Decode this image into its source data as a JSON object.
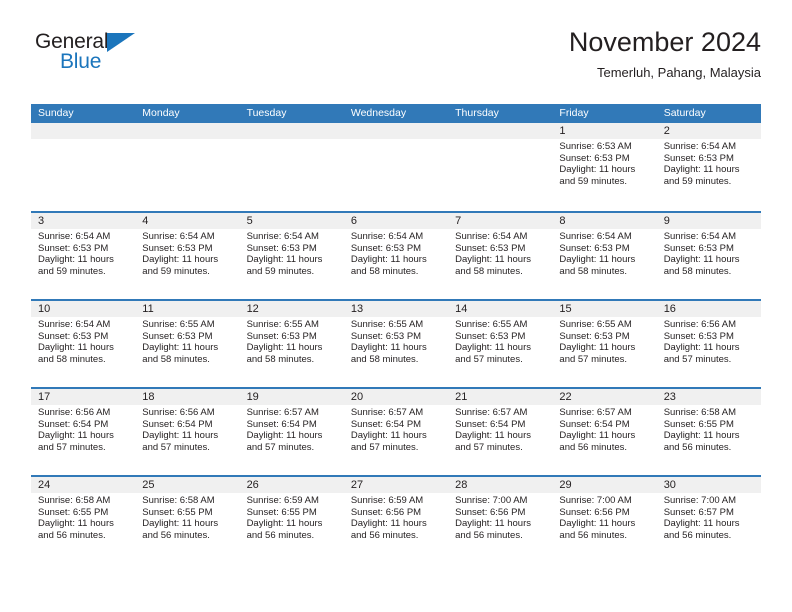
{
  "brand": {
    "name_part1": "General",
    "name_part2": "Blue",
    "color_dark": "#231f20",
    "color_blue": "#1b75bc"
  },
  "header": {
    "title": "November 2024",
    "subtitle": "Temerluh, Pahang, Malaysia"
  },
  "theme": {
    "header_blue": "#3179b8",
    "band_gray": "#f0f0f0",
    "text": "#231f20"
  },
  "weekday_headers": [
    "Sunday",
    "Monday",
    "Tuesday",
    "Wednesday",
    "Thursday",
    "Friday",
    "Saturday"
  ],
  "weeks": [
    [
      {
        "day": "",
        "sunrise": "",
        "sunset": "",
        "daylight": "",
        "empty": true
      },
      {
        "day": "",
        "sunrise": "",
        "sunset": "",
        "daylight": "",
        "empty": true
      },
      {
        "day": "",
        "sunrise": "",
        "sunset": "",
        "daylight": "",
        "empty": true
      },
      {
        "day": "",
        "sunrise": "",
        "sunset": "",
        "daylight": "",
        "empty": true
      },
      {
        "day": "",
        "sunrise": "",
        "sunset": "",
        "daylight": "",
        "empty": true
      },
      {
        "day": "1",
        "sunrise": "Sunrise: 6:53 AM",
        "sunset": "Sunset: 6:53 PM",
        "daylight": "Daylight: 11 hours and 59 minutes.",
        "empty": false
      },
      {
        "day": "2",
        "sunrise": "Sunrise: 6:54 AM",
        "sunset": "Sunset: 6:53 PM",
        "daylight": "Daylight: 11 hours and 59 minutes.",
        "empty": false
      }
    ],
    [
      {
        "day": "3",
        "sunrise": "Sunrise: 6:54 AM",
        "sunset": "Sunset: 6:53 PM",
        "daylight": "Daylight: 11 hours and 59 minutes.",
        "empty": false
      },
      {
        "day": "4",
        "sunrise": "Sunrise: 6:54 AM",
        "sunset": "Sunset: 6:53 PM",
        "daylight": "Daylight: 11 hours and 59 minutes.",
        "empty": false
      },
      {
        "day": "5",
        "sunrise": "Sunrise: 6:54 AM",
        "sunset": "Sunset: 6:53 PM",
        "daylight": "Daylight: 11 hours and 59 minutes.",
        "empty": false
      },
      {
        "day": "6",
        "sunrise": "Sunrise: 6:54 AM",
        "sunset": "Sunset: 6:53 PM",
        "daylight": "Daylight: 11 hours and 58 minutes.",
        "empty": false
      },
      {
        "day": "7",
        "sunrise": "Sunrise: 6:54 AM",
        "sunset": "Sunset: 6:53 PM",
        "daylight": "Daylight: 11 hours and 58 minutes.",
        "empty": false
      },
      {
        "day": "8",
        "sunrise": "Sunrise: 6:54 AM",
        "sunset": "Sunset: 6:53 PM",
        "daylight": "Daylight: 11 hours and 58 minutes.",
        "empty": false
      },
      {
        "day": "9",
        "sunrise": "Sunrise: 6:54 AM",
        "sunset": "Sunset: 6:53 PM",
        "daylight": "Daylight: 11 hours and 58 minutes.",
        "empty": false
      }
    ],
    [
      {
        "day": "10",
        "sunrise": "Sunrise: 6:54 AM",
        "sunset": "Sunset: 6:53 PM",
        "daylight": "Daylight: 11 hours and 58 minutes.",
        "empty": false
      },
      {
        "day": "11",
        "sunrise": "Sunrise: 6:55 AM",
        "sunset": "Sunset: 6:53 PM",
        "daylight": "Daylight: 11 hours and 58 minutes.",
        "empty": false
      },
      {
        "day": "12",
        "sunrise": "Sunrise: 6:55 AM",
        "sunset": "Sunset: 6:53 PM",
        "daylight": "Daylight: 11 hours and 58 minutes.",
        "empty": false
      },
      {
        "day": "13",
        "sunrise": "Sunrise: 6:55 AM",
        "sunset": "Sunset: 6:53 PM",
        "daylight": "Daylight: 11 hours and 58 minutes.",
        "empty": false
      },
      {
        "day": "14",
        "sunrise": "Sunrise: 6:55 AM",
        "sunset": "Sunset: 6:53 PM",
        "daylight": "Daylight: 11 hours and 57 minutes.",
        "empty": false
      },
      {
        "day": "15",
        "sunrise": "Sunrise: 6:55 AM",
        "sunset": "Sunset: 6:53 PM",
        "daylight": "Daylight: 11 hours and 57 minutes.",
        "empty": false
      },
      {
        "day": "16",
        "sunrise": "Sunrise: 6:56 AM",
        "sunset": "Sunset: 6:53 PM",
        "daylight": "Daylight: 11 hours and 57 minutes.",
        "empty": false
      }
    ],
    [
      {
        "day": "17",
        "sunrise": "Sunrise: 6:56 AM",
        "sunset": "Sunset: 6:54 PM",
        "daylight": "Daylight: 11 hours and 57 minutes.",
        "empty": false
      },
      {
        "day": "18",
        "sunrise": "Sunrise: 6:56 AM",
        "sunset": "Sunset: 6:54 PM",
        "daylight": "Daylight: 11 hours and 57 minutes.",
        "empty": false
      },
      {
        "day": "19",
        "sunrise": "Sunrise: 6:57 AM",
        "sunset": "Sunset: 6:54 PM",
        "daylight": "Daylight: 11 hours and 57 minutes.",
        "empty": false
      },
      {
        "day": "20",
        "sunrise": "Sunrise: 6:57 AM",
        "sunset": "Sunset: 6:54 PM",
        "daylight": "Daylight: 11 hours and 57 minutes.",
        "empty": false
      },
      {
        "day": "21",
        "sunrise": "Sunrise: 6:57 AM",
        "sunset": "Sunset: 6:54 PM",
        "daylight": "Daylight: 11 hours and 57 minutes.",
        "empty": false
      },
      {
        "day": "22",
        "sunrise": "Sunrise: 6:57 AM",
        "sunset": "Sunset: 6:54 PM",
        "daylight": "Daylight: 11 hours and 56 minutes.",
        "empty": false
      },
      {
        "day": "23",
        "sunrise": "Sunrise: 6:58 AM",
        "sunset": "Sunset: 6:55 PM",
        "daylight": "Daylight: 11 hours and 56 minutes.",
        "empty": false
      }
    ],
    [
      {
        "day": "24",
        "sunrise": "Sunrise: 6:58 AM",
        "sunset": "Sunset: 6:55 PM",
        "daylight": "Daylight: 11 hours and 56 minutes.",
        "empty": false
      },
      {
        "day": "25",
        "sunrise": "Sunrise: 6:58 AM",
        "sunset": "Sunset: 6:55 PM",
        "daylight": "Daylight: 11 hours and 56 minutes.",
        "empty": false
      },
      {
        "day": "26",
        "sunrise": "Sunrise: 6:59 AM",
        "sunset": "Sunset: 6:55 PM",
        "daylight": "Daylight: 11 hours and 56 minutes.",
        "empty": false
      },
      {
        "day": "27",
        "sunrise": "Sunrise: 6:59 AM",
        "sunset": "Sunset: 6:56 PM",
        "daylight": "Daylight: 11 hours and 56 minutes.",
        "empty": false
      },
      {
        "day": "28",
        "sunrise": "Sunrise: 7:00 AM",
        "sunset": "Sunset: 6:56 PM",
        "daylight": "Daylight: 11 hours and 56 minutes.",
        "empty": false
      },
      {
        "day": "29",
        "sunrise": "Sunrise: 7:00 AM",
        "sunset": "Sunset: 6:56 PM",
        "daylight": "Daylight: 11 hours and 56 minutes.",
        "empty": false
      },
      {
        "day": "30",
        "sunrise": "Sunrise: 7:00 AM",
        "sunset": "Sunset: 6:57 PM",
        "daylight": "Daylight: 11 hours and 56 minutes.",
        "empty": false
      }
    ]
  ]
}
